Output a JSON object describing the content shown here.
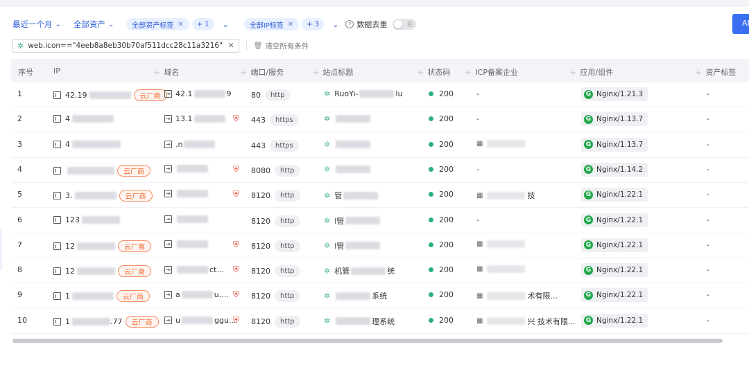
{
  "filters": {
    "time_range": "最近一个月",
    "asset_scope": "全部资产",
    "asset_tag": "全部资产标签",
    "asset_tag_extra": "+ 1",
    "ip_tag": "全部IP标签",
    "ip_tag_extra": "+ 3",
    "dedup_label": "数据去重",
    "dedup_toggle_text": "否",
    "query": "web.icon==\"4eeb8a8eb30b70af511dcc28c11a3216\"",
    "clear_all": "清空所有条件",
    "api_button": "AP"
  },
  "table": {
    "headers": {
      "index": "序号",
      "ip": "IP",
      "domain": "域名",
      "port": "端口/服务",
      "title": "站点标题",
      "status": "状态码",
      "icp": "ICP备案企业",
      "app": "应用/组件",
      "asset_tag": "资产标签"
    },
    "rows": [
      {
        "index": "1",
        "ip": "42.19",
        "cloud": "云厂商",
        "domain": "42.1",
        "domain_tail": "9",
        "port": "80",
        "proto": "http",
        "title": "RuoYi-",
        "title_tail": "lu",
        "status": "200",
        "icp": "-",
        "app": "Nginx/1.21.3",
        "tag": "-"
      },
      {
        "index": "2",
        "ip": "4",
        "cloud": "",
        "domain": "13.1",
        "domain_tail": "",
        "port": "443",
        "proto": "https",
        "title": "",
        "title_tail": "",
        "status": "200",
        "icp": "-",
        "app": "Nginx/1.13.7",
        "tag": "-"
      },
      {
        "index": "3",
        "ip": "4",
        "cloud": "",
        "domain": ".n",
        "domain_tail": "",
        "port": "443",
        "proto": "https",
        "title": "",
        "title_tail": "",
        "status": "200",
        "icp": "",
        "app": "Nginx/1.13.7",
        "tag": "-"
      },
      {
        "index": "4",
        "ip": "",
        "cloud": "云厂商",
        "domain": "",
        "domain_tail": "",
        "port": "8080",
        "proto": "http",
        "title": "",
        "title_tail": "",
        "status": "200",
        "icp": "-",
        "app": "Nginx/1.14.2",
        "tag": "-"
      },
      {
        "index": "5",
        "ip": "3.",
        "cloud": "云厂商",
        "domain": "",
        "domain_tail": "",
        "port": "8120",
        "proto": "http",
        "title": "管",
        "title_tail": "",
        "status": "200",
        "icp": "技",
        "app": "Nginx/1.22.1",
        "tag": "-"
      },
      {
        "index": "6",
        "ip": "123",
        "cloud": "",
        "domain": "",
        "domain_tail": "",
        "port": "8120",
        "proto": "http",
        "title": "l管",
        "title_tail": "",
        "status": "200",
        "icp": "-",
        "app": "Nginx/1.22.1",
        "tag": "-"
      },
      {
        "index": "7",
        "ip": "12",
        "cloud": "云厂商",
        "domain": "",
        "domain_tail": "",
        "port": "8120",
        "proto": "http",
        "title": "l管",
        "title_tail": "",
        "status": "200",
        "icp": "",
        "app": "Nginx/1.22.1",
        "tag": "-"
      },
      {
        "index": "8",
        "ip": "12",
        "cloud": "云厂商",
        "domain": "",
        "domain_tail": "ct...",
        "port": "8120",
        "proto": "http",
        "title": "机管",
        "title_tail": "统",
        "status": "200",
        "icp": "",
        "app": "Nginx/1.22.1",
        "tag": "-"
      },
      {
        "index": "9",
        "ip": "1",
        "cloud": "云厂商",
        "domain": "a",
        "domain_tail": "u....",
        "port": "8120",
        "proto": "http",
        "title": "",
        "title_tail": "系统",
        "status": "200",
        "icp": "术有限...",
        "app": "Nginx/1.22.1",
        "tag": "-"
      },
      {
        "index": "10",
        "ip": "1",
        "ip_tail": ".77",
        "cloud": "云厂商",
        "domain": "u",
        "domain_tail": "ggu...",
        "port": "8120",
        "proto": "http",
        "title": "",
        "title_tail": "理系统",
        "status": "200",
        "icp": "兴 技术有限...",
        "app": "Nginx/1.22.1",
        "tag": "-"
      }
    ]
  },
  "colors": {
    "accent": "#2a5bd7",
    "cloud_tag": "#f36b34",
    "status_ok": "#2cb079",
    "nginx": "#20a94b",
    "shield": "#e0483b"
  }
}
